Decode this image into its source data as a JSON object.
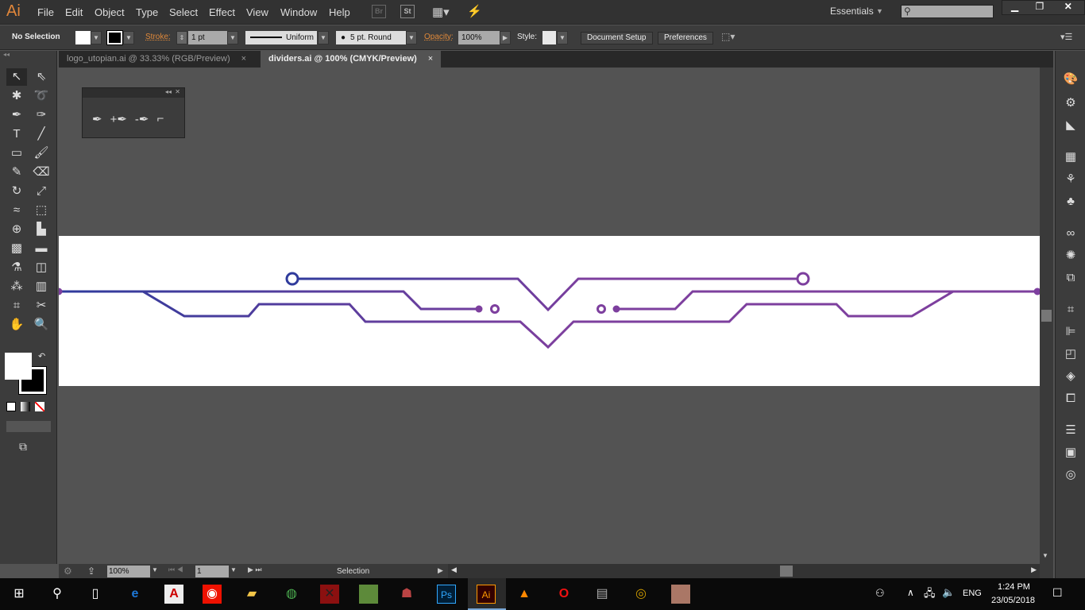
{
  "app": {
    "logo": "Ai",
    "menu": [
      "File",
      "Edit",
      "Object",
      "Type",
      "Select",
      "Effect",
      "View",
      "Window",
      "Help"
    ],
    "bridge": "Br",
    "stock": "St",
    "workspace": "Essentials",
    "search_placeholder": ""
  },
  "control": {
    "selection": "No Selection",
    "stroke_label": "Stroke:",
    "stroke_value": "1 pt",
    "profile": "Uniform",
    "brush": "5 pt. Round",
    "opacity_label": "Opacity:",
    "opacity_value": "100%",
    "style_label": "Style:",
    "doc_setup": "Document Setup",
    "preferences": "Preferences"
  },
  "tabs": [
    {
      "label": "logo_utopian.ai @ 33.33% (RGB/Preview)",
      "close": "×"
    },
    {
      "label": "dividers.ai @ 100% (CMYK/Preview)",
      "close": "×"
    }
  ],
  "status": {
    "zoom": "100%",
    "page": "1",
    "tool": "Selection"
  },
  "taskbar": {
    "time": "1:24 PM",
    "date": "23/05/2018",
    "lang": "ENG"
  },
  "colors": {
    "line_start": "#2e3b9c",
    "line_end": "#7d3f9e",
    "accent": "#e0863a"
  }
}
